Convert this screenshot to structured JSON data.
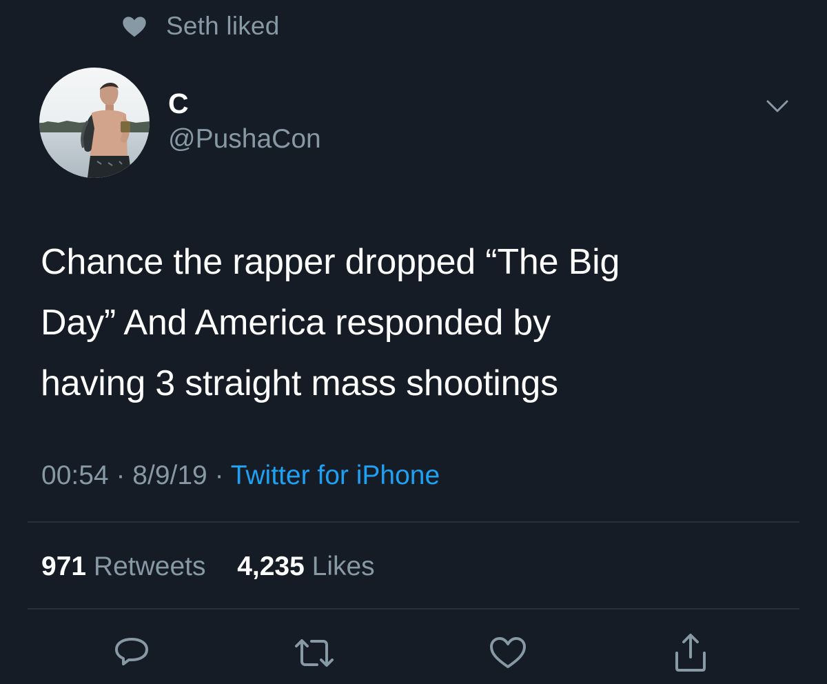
{
  "social_context": {
    "icon": "heart-icon",
    "text": "Seth liked"
  },
  "tweet": {
    "author": {
      "name": "C",
      "handle": "@PushaCon",
      "avatar": "avatar-photo"
    },
    "caret_icon": "chevron-down-icon",
    "lines": [
      "Chance the rapper dropped “The Big",
      "Day” And America responded by",
      "having 3 straight mass shootings"
    ],
    "time": "00:54",
    "date": "8/9/19",
    "separator": "·",
    "source": "Twitter for iPhone"
  },
  "stats": {
    "retweets_count": "971",
    "retweets_label": "Retweets",
    "likes_count": "4,235",
    "likes_label": "Likes"
  },
  "actions": [
    {
      "name": "reply",
      "icon": "reply-icon"
    },
    {
      "name": "retweet",
      "icon": "retweet-icon"
    },
    {
      "name": "like",
      "icon": "heart-outline-icon"
    },
    {
      "name": "share",
      "icon": "share-icon"
    }
  ],
  "colors": {
    "background": "#151c25",
    "secondary_text": "#8899a6",
    "link": "#1da1f2",
    "divider": "#27313d"
  }
}
